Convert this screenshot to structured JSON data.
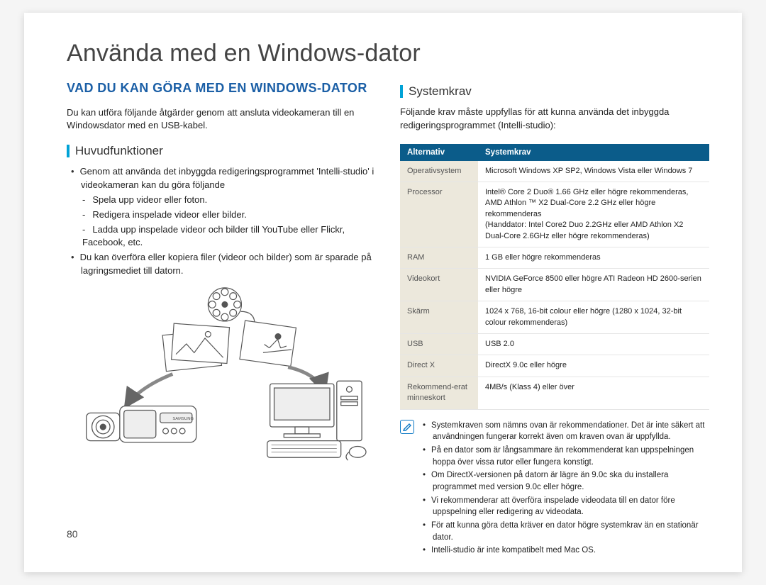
{
  "title": "Använda med en Windows-dator",
  "page_number": "80",
  "left": {
    "heading": "VAD DU KAN GÖRA MED EN WINDOWS-DATOR",
    "intro": "Du kan utföra följande åtgärder genom att ansluta videokameran till en Windowsdator med en USB-kabel.",
    "subheading": "Huvudfunktioner",
    "bullet1": "Genom att använda det inbyggda redigeringsprogrammet 'Intelli-studio' i videokameran kan du göra följande",
    "dashes": [
      "Spela upp videor eller foton.",
      "Redigera inspelade videor eller bilder.",
      "Ladda upp inspelade videor och bilder till YouTube eller Flickr, Facebook, etc."
    ],
    "bullet2": "Du kan överföra eller kopiera filer (videor och bilder) som är sparade på lagringsmediet till datorn."
  },
  "right": {
    "subheading": "Systemkrav",
    "intro": "Följande krav måste uppfyllas för att kunna använda det inbyggda redigeringsprogrammet (Intelli-studio):",
    "table_head": {
      "col1": "Alternativ",
      "col2": "Systemkrav"
    },
    "rows": [
      {
        "k": "Operativsystem",
        "v": "Microsoft Windows XP SP2, Windows Vista eller Windows 7"
      },
      {
        "k": "Processor",
        "v": "Intel® Core 2 Duo® 1.66 GHz eller högre rekommenderas, AMD Athlon ™ X2 Dual-Core 2.2 GHz eller högre rekommenderas\n(Handdator: Intel Core2 Duo 2.2GHz eller AMD Athlon X2 Dual-Core 2.6GHz eller högre rekommenderas)"
      },
      {
        "k": "RAM",
        "v": "1 GB eller högre rekommenderas"
      },
      {
        "k": "Videokort",
        "v": "NVIDIA GeForce 8500 eller högre ATI Radeon HD 2600-serien eller högre"
      },
      {
        "k": "Skärm",
        "v": "1024 x 768, 16-bit colour eller högre (1280 x 1024, 32-bit colour rekommenderas)"
      },
      {
        "k": "USB",
        "v": "USB 2.0"
      },
      {
        "k": "Direct X",
        "v": "DirectX 9.0c eller högre"
      },
      {
        "k": "Rekommend-erat minneskort",
        "v": "4MB/s (Klass 4) eller över"
      }
    ],
    "notes": [
      "Systemkraven som nämns ovan är rekommendationer. Det är inte säkert att användningen fungerar korrekt även om kraven ovan är uppfyllda.",
      "På en dator som är långsammare än rekommenderat kan uppspelningen hoppa över vissa rutor eller fungera konstigt.",
      "Om DirectX-versionen på datorn är lägre än 9.0c ska du installera programmet med version 9.0c eller högre.",
      "Vi rekommenderar att överföra inspelade videodata till en dator före uppspelning eller redigering av videodata.",
      "För att kunna göra detta kräver en dator högre systemkrav än en stationär dator.",
      "Intelli-studio är inte kompatibelt med Mac OS."
    ]
  }
}
